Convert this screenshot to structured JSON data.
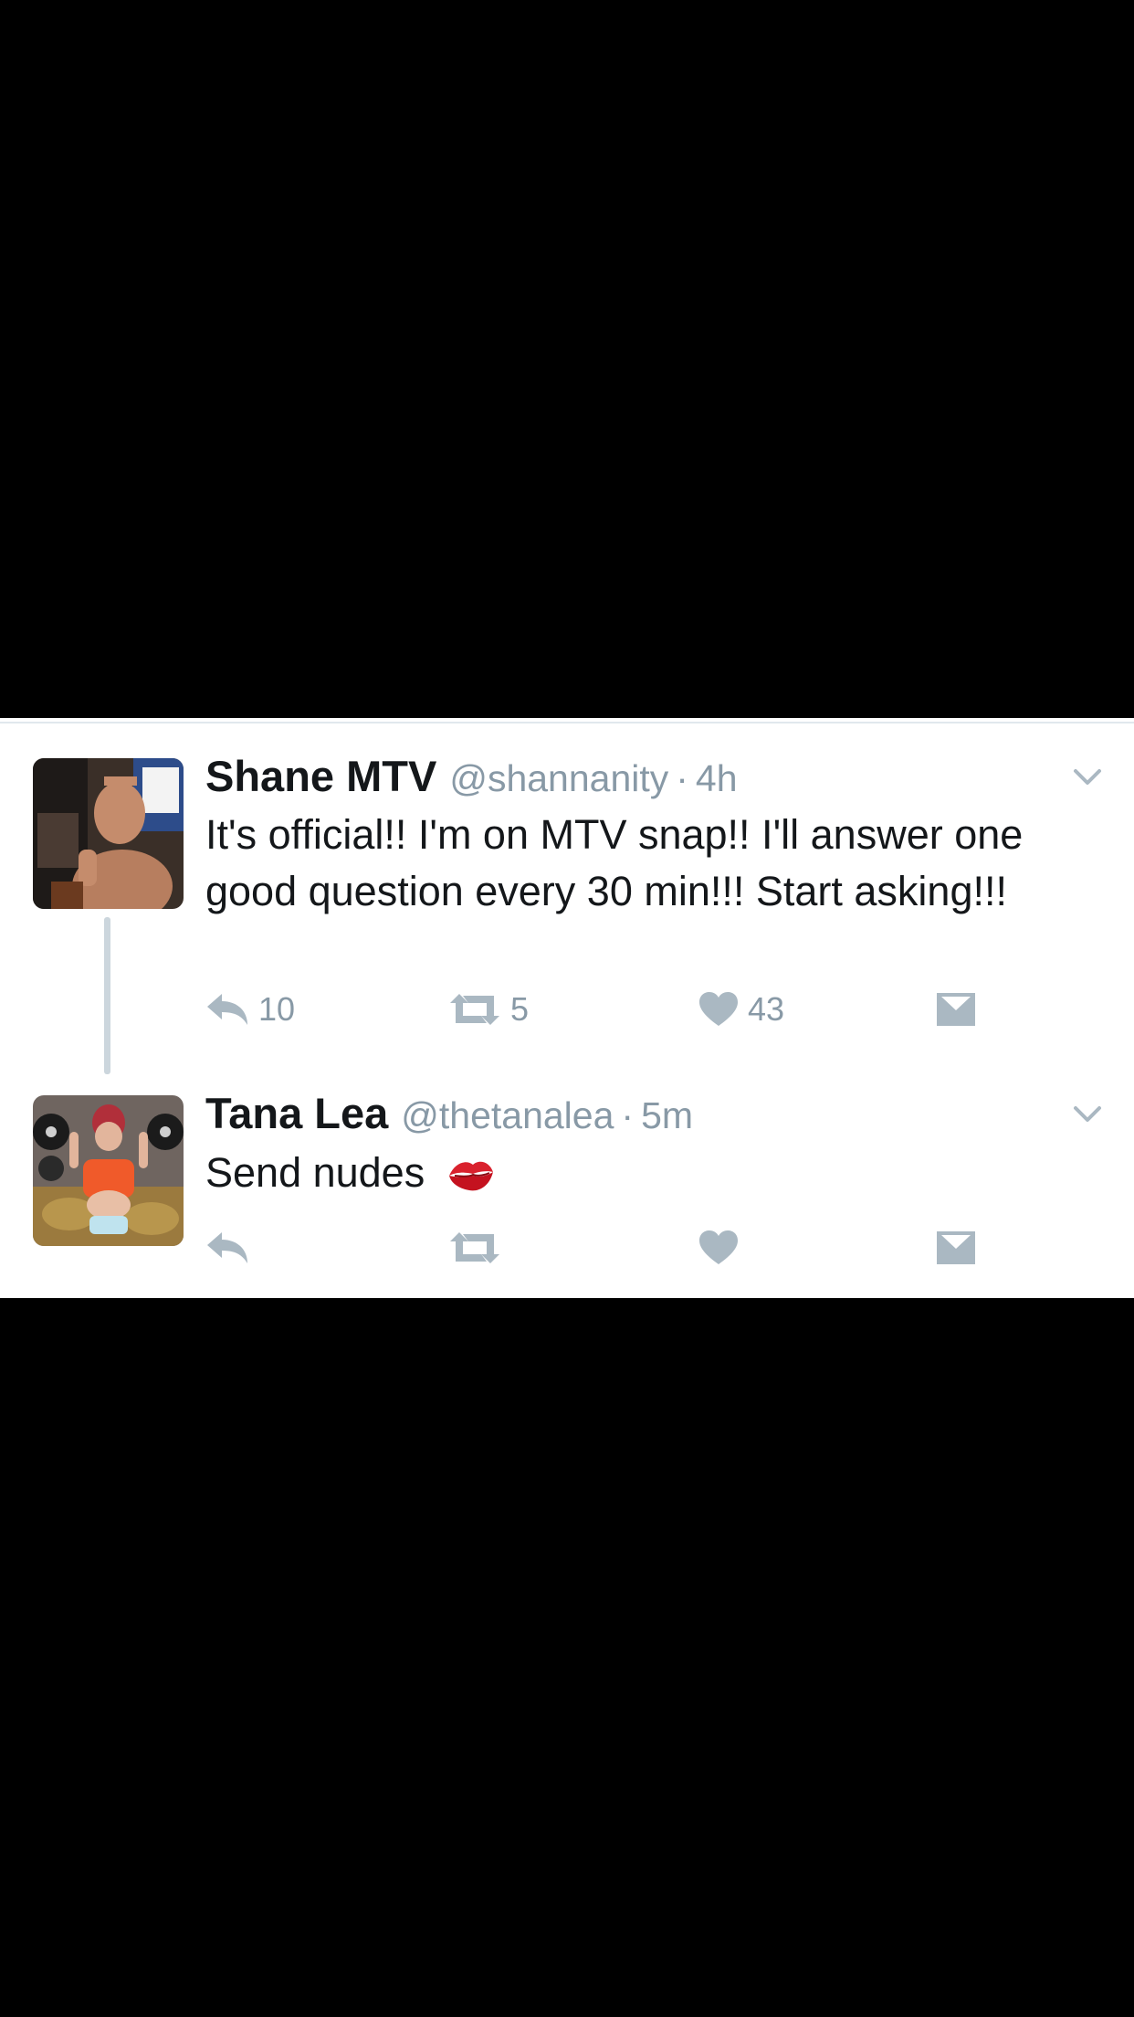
{
  "tweets": [
    {
      "name": "Shane MTV",
      "handle": "@shannanity",
      "separator": "·",
      "time": "4h",
      "text": "It's official!! I'm on MTV snap!! I'll answer one good question every 30 min!!! Start asking!!!",
      "actions": {
        "reply_count": "10",
        "retweet_count": "5",
        "like_count": "43"
      }
    },
    {
      "name": "Tana Lea",
      "handle": "@thetanalea",
      "separator": "·",
      "time": "5m",
      "text": "Send nudes",
      "emoji": "kiss-mark-emoji",
      "actions": {
        "reply_count": "",
        "retweet_count": "",
        "like_count": ""
      }
    }
  ],
  "colors": {
    "name": "#14171a",
    "meta": "#8899a6",
    "thread_line": "#ccd6dd",
    "icon": "#aab8c2",
    "kiss": "#d9212d"
  },
  "icons": {
    "reply": "reply-icon",
    "retweet": "retweet-icon",
    "like": "heart-icon",
    "dm": "direct-message-icon",
    "menu": "chevron-down-icon"
  }
}
